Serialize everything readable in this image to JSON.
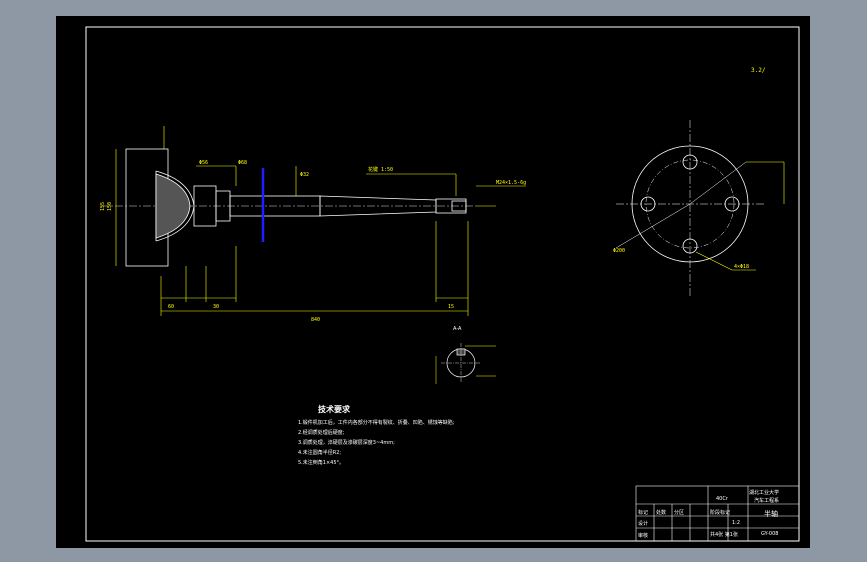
{
  "drawing": {
    "scale_note": "3.2/",
    "section_label": "A-A",
    "technical_requirements": {
      "title": "技术要求",
      "items": [
        "1.锻件机加工后，工件内各部分不得有裂纹、折叠、凹陷、锈蚀等缺陷;",
        "2.经调质处理后硬度;",
        "3.调质处理，淬硬层及渗碳层深度3~4mm;",
        "4.未注圆角半径R2;",
        "5.未注倒角1×45°。"
      ]
    },
    "dimensions": {
      "overall_length": "840",
      "flange_diameter": "Φ200",
      "bolt_hole": "4×Φ18",
      "dim_a": "60",
      "dim_b": "30",
      "dim_c": "155",
      "dim_d": "150",
      "dim_e": "15",
      "hub_dia_1": "Φ56",
      "hub_dia_2": "Φ68",
      "spline_note": "花键 1:50",
      "thread_note": "M24×1.5-6g",
      "key_dia": "Φ32"
    },
    "title_block": {
      "school": "湖北工业大学",
      "dept": "汽车工程系",
      "part_name": "半轴",
      "drawing_no": "GY-008",
      "material": "40Cr",
      "scale": "1:2",
      "sheet": "共4张 第1张",
      "row_labels": [
        "标记",
        "处数",
        "分区",
        "更改文件号",
        "签名",
        "年月日"
      ],
      "sign_labels": [
        "设计",
        "审核",
        "工艺",
        "标准化",
        "批准"
      ],
      "stage_labels": [
        "阶段标记",
        "重量",
        "比例"
      ]
    },
    "colors": {
      "outer_bg": "#8e97a4",
      "canvas": "#000000",
      "frame": "#ffffff",
      "geometry": "#ffffff",
      "dimension": "#ffff00",
      "section_line": "#2020ff"
    }
  }
}
